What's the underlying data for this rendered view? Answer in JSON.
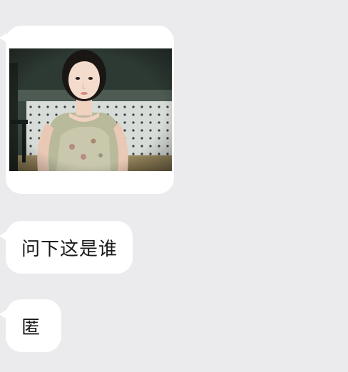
{
  "chat": {
    "messages": [
      {
        "type": "image",
        "alt": ""
      },
      {
        "type": "text",
        "text": "问下这是谁"
      },
      {
        "type": "text",
        "text": "匿"
      }
    ]
  },
  "colors": {
    "background": "#ebebee",
    "bubble": "#ffffff",
    "text": "#1a1a1a"
  }
}
